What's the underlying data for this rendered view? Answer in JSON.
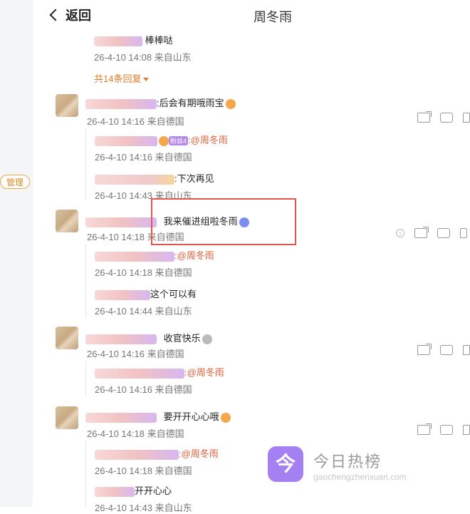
{
  "sidebar": {
    "manage_label": "管理"
  },
  "header": {
    "back_label": "返回",
    "title": "周冬雨"
  },
  "top_reply": {
    "text": "棒棒哒",
    "meta": "26-4-10 14:08 来自山东",
    "more": "共14条回复"
  },
  "comments": [
    {
      "text": ":后会有期哦雨宝",
      "meta": "26-4-10 14:16 来自德国",
      "replies": [
        {
          "badge": "粉丝4",
          "text": ":@周冬雨",
          "meta": "26-4-10 14:16 来自德国"
        },
        {
          "text": ":下次再见",
          "meta": "26-4-10 14:43 来自山东"
        }
      ]
    },
    {
      "text": "我来催进组啦冬雨",
      "meta": "26-4-10 14:18 来自德国",
      "replies": [
        {
          "text": ":@周冬雨",
          "meta": "26-4-10 14:18 来自德国"
        },
        {
          "text": "这个可以有",
          "meta": "26-4-10 14:44 来自山东"
        }
      ]
    },
    {
      "text": "收官快乐",
      "meta": "26-4-10 14:16 来自德国",
      "replies": [
        {
          "text": ":@周冬雨",
          "meta": "26-4-10 14:16 来自德国"
        }
      ]
    },
    {
      "text": "要开开心心哦",
      "meta": "26-4-10 14:18 来自德国",
      "replies": [
        {
          "text": ":@周冬雨",
          "meta": "26-4-10 14:18 来自德国"
        },
        {
          "text": "开开心心",
          "meta": "26-4-10 14:43 来自山东"
        }
      ]
    }
  ],
  "watermark": {
    "icon_char": "今",
    "title": "今日热榜",
    "url": "gaochengzhenxuan.com"
  }
}
